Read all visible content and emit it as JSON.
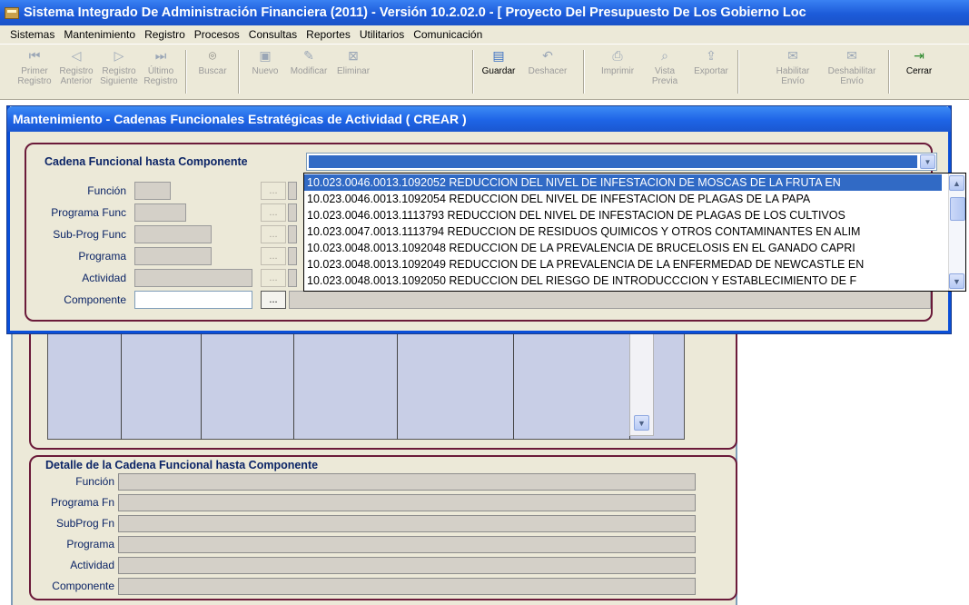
{
  "window": {
    "title": "Sistema Integrado De Administración Financiera (2011) - Versión 10.2.02.0 - [ Proyecto Del Presupuesto De Los Gobierno Loc"
  },
  "menu": [
    "Sistemas",
    "Mantenimiento",
    "Registro",
    "Procesos",
    "Consultas",
    "Reportes",
    "Utilitarios",
    "Comunicación"
  ],
  "toolbar": {
    "primer": [
      "Primer",
      "Registro"
    ],
    "anterior": [
      "Registro",
      "Anterior"
    ],
    "siguiente": [
      "Registro",
      "Siguiente"
    ],
    "ultimo": [
      "Último",
      "Registro"
    ],
    "buscar": "Buscar",
    "nuevo": "Nuevo",
    "modificar": "Modificar",
    "eliminar": "Eliminar",
    "guardar": "Guardar",
    "deshacer": "Deshacer",
    "imprimir": "Imprimir",
    "vista": [
      "Vista",
      "Previa"
    ],
    "exportar": "Exportar",
    "habilitar": [
      "Habilitar",
      "Envío"
    ],
    "deshabilitar": [
      "Deshabilitar",
      "Envío"
    ],
    "cerrar": "Cerrar"
  },
  "dialog": {
    "title": "Mantenimiento - Cadenas Funcionales Estratégicas de Actividad ( CREAR )",
    "cadena_label": "Cadena Funcional hasta Componente",
    "fields": {
      "funcion": "Función",
      "programa_func": "Programa Func",
      "subprog_func": "Sub-Prog Func",
      "programa": "Programa",
      "actividad": "Actividad",
      "componente": "Componente"
    },
    "dots": "..."
  },
  "dropdown_items": [
    "10.023.0046.0013.1092052 REDUCCION DEL NIVEL DE INFESTACION DE MOSCAS DE LA FRUTA EN",
    "10.023.0046.0013.1092054 REDUCCION DEL NIVEL DE INFESTACION DE PLAGAS DE LA PAPA",
    "10.023.0046.0013.1113793 REDUCCION DEL NIVEL DE INFESTACION DE PLAGAS DE LOS CULTIVOS",
    "10.023.0047.0013.1113794 REDUCCION DE RESIDUOS QUIMICOS Y OTROS CONTAMINANTES EN ALIM",
    "10.023.0048.0013.1092048 REDUCCION DE LA PREVALENCIA DE BRUCELOSIS EN EL GANADO CAPRI",
    "10.023.0048.0013.1092049 REDUCCION DE LA PREVALENCIA DE LA ENFERMEDAD DE NEWCASTLE EN",
    "10.023.0048.0013.1092050 REDUCCION DEL RIESGO DE INTRODUCCCION Y ESTABLECIMIENTO DE F"
  ],
  "detail": {
    "title": "Detalle de la Cadena Funcional hasta Componente",
    "labels": [
      "Función",
      "Programa Fn",
      "SubProg Fn",
      "Programa",
      "Actividad",
      "Componente"
    ]
  }
}
